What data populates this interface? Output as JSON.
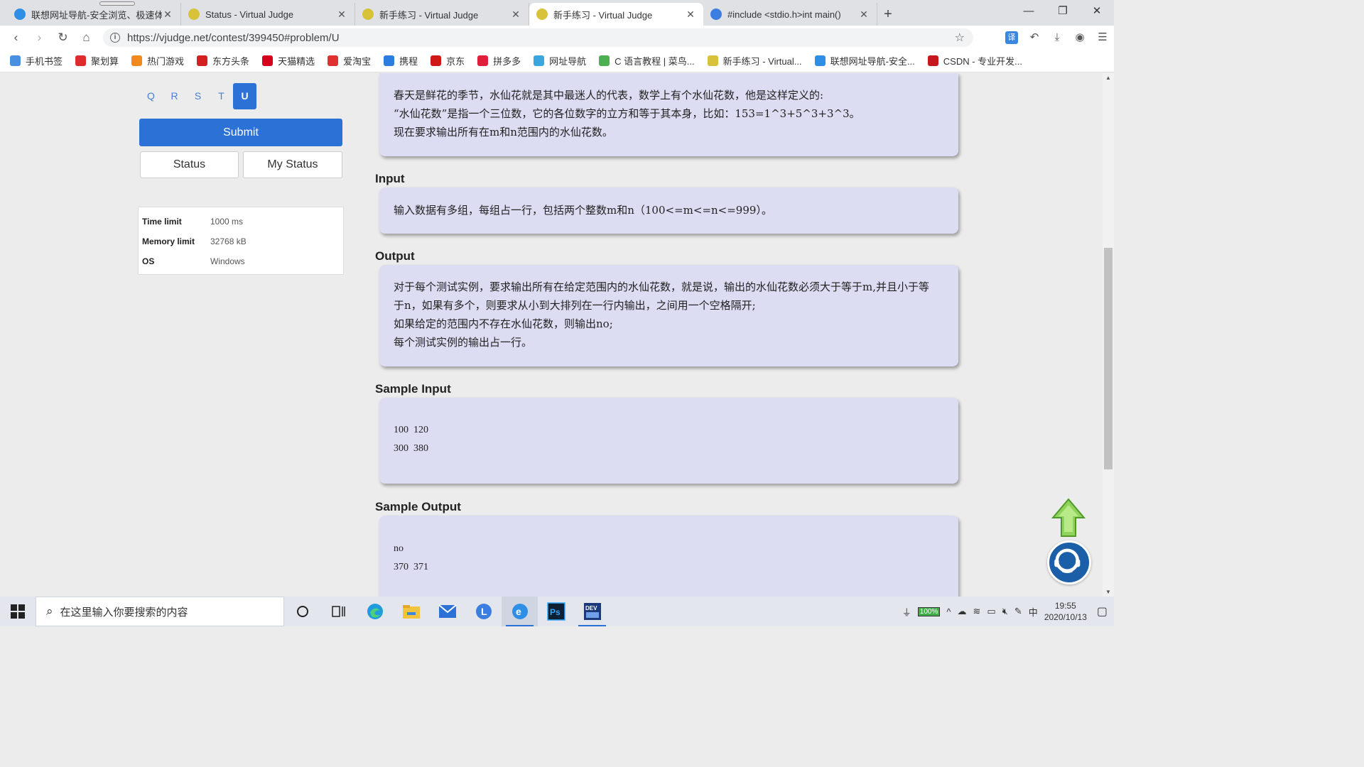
{
  "browser": {
    "tabs": [
      {
        "title": "联想网址导航-安全浏览、极速体",
        "favicon_color": "#2f8ee6",
        "active": false
      },
      {
        "title": "Status - Virtual Judge",
        "favicon_color": "#d8c23a",
        "active": false
      },
      {
        "title": "新手练习 - Virtual Judge",
        "favicon_color": "#d8c23a",
        "active": false
      },
      {
        "title": "新手练习 - Virtual Judge",
        "favicon_color": "#d8c23a",
        "active": true
      },
      {
        "title": "#include <stdio.h>int main()",
        "favicon_color": "#3b7de0",
        "active": false
      }
    ],
    "url": "https://vjudge.net/contest/399450#problem/U",
    "bookmarks": [
      {
        "label": "手机书签",
        "color": "#4a8fe0"
      },
      {
        "label": "聚划算",
        "color": "#e02b2b"
      },
      {
        "label": "热门游戏",
        "color": "#f08a1c"
      },
      {
        "label": "东方头条",
        "color": "#d42020"
      },
      {
        "label": "天猫精选",
        "color": "#d6001c"
      },
      {
        "label": "爱淘宝",
        "color": "#e03030"
      },
      {
        "label": "携程",
        "color": "#2b7de0"
      },
      {
        "label": "京东",
        "color": "#d01818"
      },
      {
        "label": "拼多多",
        "color": "#e0203a"
      },
      {
        "label": "网址导航",
        "color": "#3aa6e0"
      },
      {
        "label": "C 语言教程 | 菜鸟...",
        "color": "#4caf50"
      },
      {
        "label": "新手练习 - Virtual...",
        "color": "#d8c23a"
      },
      {
        "label": "联想网址导航-安全...",
        "color": "#2f8ee6"
      },
      {
        "label": "CSDN - 专业开发...",
        "color": "#c8161d"
      }
    ]
  },
  "sidebar": {
    "letters": [
      "Q",
      "R",
      "S",
      "T",
      "U"
    ],
    "active_letter": "U",
    "submit_label": "Submit",
    "status_label": "Status",
    "my_status_label": "My Status",
    "info": [
      {
        "key": "Time limit",
        "value": "1000 ms"
      },
      {
        "key": "Memory limit",
        "value": "32768 kB"
      },
      {
        "key": "OS",
        "value": "Windows"
      }
    ]
  },
  "problem": {
    "description_lines": [
      "春天是鲜花的季节，水仙花就是其中最迷人的代表，数学上有个水仙花数，他是这样定义的:",
      "“水仙花数”是指一个三位数，它的各位数字的立方和等于其本身，比如：153=1^3+5^3+3^3。",
      "现在要求输出所有在m和n范围内的水仙花数。"
    ],
    "input_title": "Input",
    "input_text": "输入数据有多组，每组占一行，包括两个整数m和n（100<=m<=n<=999）。",
    "output_title": "Output",
    "output_lines": [
      "对于每个测试实例，要求输出所有在给定范围内的水仙花数，就是说，输出的水仙花数必须大于等于m,并且小于等",
      "于n，如果有多个，则要求从小到大排列在一行内输出，之间用一个空格隔开;",
      "如果给定的范围内不存在水仙花数，则输出no;",
      "每个测试实例的输出占一行。"
    ],
    "sample_input_title": "Sample Input",
    "sample_input_lines": [
      "100  120",
      "300  380"
    ],
    "sample_output_title": "Sample Output",
    "sample_output_lines": [
      "no",
      "370  371"
    ]
  },
  "taskbar": {
    "search_placeholder": "在这里输入你要搜索的内容",
    "battery": "100%",
    "ime": "中",
    "time": "19:55",
    "date": "2020/10/13"
  }
}
